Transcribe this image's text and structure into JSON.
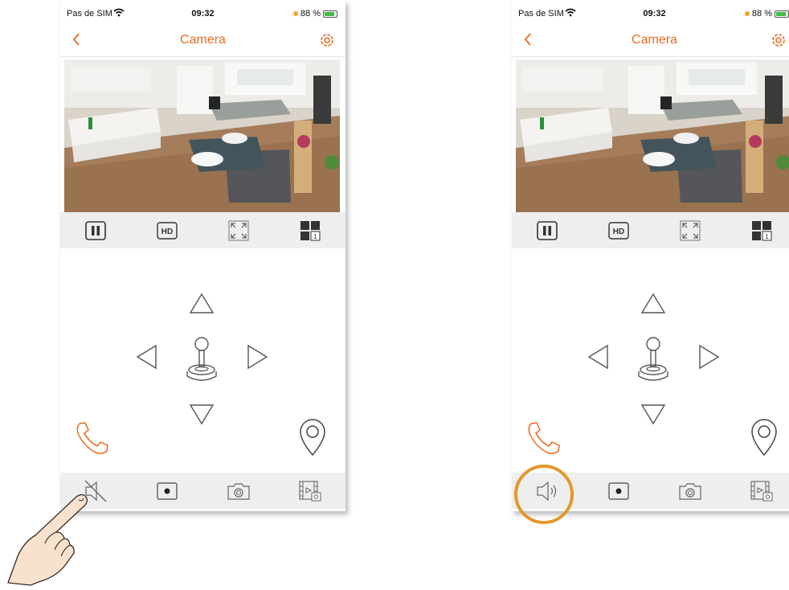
{
  "status": {
    "carrier": "Pas de SIM",
    "time": "09:32",
    "battery": "88 %"
  },
  "header": {
    "title": "Camera"
  },
  "colors": {
    "accent": "#ec6a1f",
    "highlight": "#e2982a",
    "toolbar_bg": "#eeeeee",
    "icon_gray": "#555555"
  },
  "controls": {
    "hd_label": "HD",
    "split_label": "1"
  },
  "icons": {
    "controls": [
      "pause-icon",
      "hd-icon",
      "fullscreen-icon",
      "split-view-icon"
    ],
    "ptz": [
      "arrow-up-icon",
      "arrow-left-icon",
      "joystick-icon",
      "arrow-right-icon",
      "arrow-down-icon"
    ],
    "bottom_left": [
      "speaker-muted-icon",
      "record-icon",
      "camera-icon",
      "gallery-icon"
    ],
    "bottom_right": [
      "speaker-icon",
      "record-icon",
      "camera-icon",
      "gallery-icon"
    ],
    "extra": [
      "phone-icon",
      "location-pin-icon",
      "settings-gear-icon",
      "back-chevron-icon"
    ]
  }
}
